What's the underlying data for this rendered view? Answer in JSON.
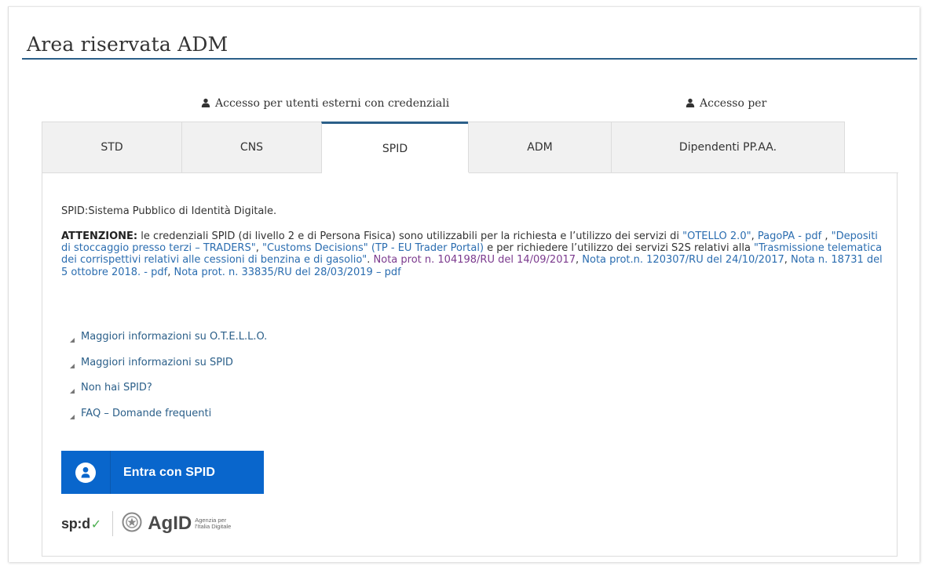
{
  "page": {
    "title": "Area riservata ADM"
  },
  "access_groups": {
    "external": "Accesso per utenti esterni con credenziali",
    "internal": "Accesso per"
  },
  "tabs": [
    {
      "label": "STD",
      "active": false
    },
    {
      "label": "CNS",
      "active": false
    },
    {
      "label": "SPID",
      "active": true
    },
    {
      "label": "ADM",
      "active": false
    },
    {
      "label": "Dipendenti PP.AA.",
      "active": false
    }
  ],
  "content": {
    "intro": "SPID:Sistema Pubblico di Identità Digitale.",
    "attention": {
      "label": "ATTENZIONE:",
      "t1": " le credenziali SPID (di livello 2 e di Persona Fisica) sono utilizzabili per la richiesta e l’utilizzo dei servizi di ",
      "l_otello": "\"OTELLO 2.0\"",
      "t2": ", ",
      "l_pagopa": "PagoPA - pdf",
      "t3": " , ",
      "l_depositi": "\"Depositi di stoccaggio presso terzi – TRADERS\"",
      "t4": ", ",
      "l_customs": "\"Customs Decisions\" (TP - EU Trader Portal)",
      "t5": " e per richiedere l’utilizzo dei servizi S2S relativi alla ",
      "l_trasmissione": "\"Trasmissione telematica dei corrispettivi relativi alle cessioni di benzina e di gasolio\"",
      "t6": ". ",
      "l_nota1": "Nota prot n. 104198/RU del 14/09/2017",
      "t7": ",  ",
      "l_nota2": "Nota prot.n. 120307/RU del 24/10/2017",
      "t8": ", ",
      "l_nota3": "Nota n. 18731 del 5 ottobre 2018. - pdf",
      "t9": ", ",
      "l_nota4": "Nota prot. n. 33835/RU del 28/03/2019 – pdf"
    },
    "links": [
      "Maggiori informazioni su O.T.E.L.L.O.",
      "Maggiori informazioni su SPID",
      "Non hai SPID?",
      "FAQ – Domande frequenti"
    ],
    "spid_button": "Entra con SPID"
  },
  "logos": {
    "spid": "sp:d",
    "agid": "AgID",
    "agid_subtitle": "Agenzia per\nl'Italia Digitale"
  },
  "colors": {
    "accent": "#2b5f89",
    "spid_blue": "#0966cc",
    "link": "#2b6db0",
    "visited_link": "#7b3a8e"
  }
}
